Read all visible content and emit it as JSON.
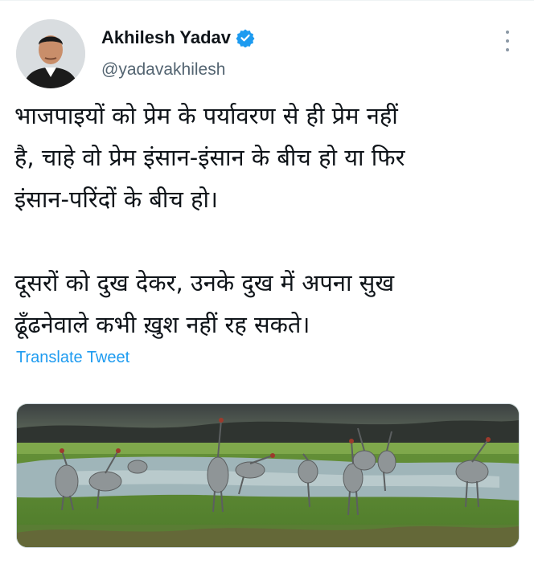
{
  "tweet": {
    "author_name": "Akhilesh Yadav",
    "handle": "@yadavakhilesh",
    "text": "भाजपाइयों को प्रेम के पर्यावरण से ही प्रेम नहीं\nहै, चाहे वो प्रेम इंसान-इंसान के बीच हो या फिर\nइंसान-परिंदों के बीच हो।\n\nदूसरों को दुख देकर, उनके दुख में अपना सुख\nढूँढनेवाले कभी ख़ुश नहीं रह सकते।",
    "translate_label": "Translate Tweet"
  },
  "icons": {
    "verified": "verified-badge-icon",
    "more": "more-options-icon"
  },
  "colors": {
    "accent": "#1d9bf0",
    "secondary_text": "#536471"
  }
}
